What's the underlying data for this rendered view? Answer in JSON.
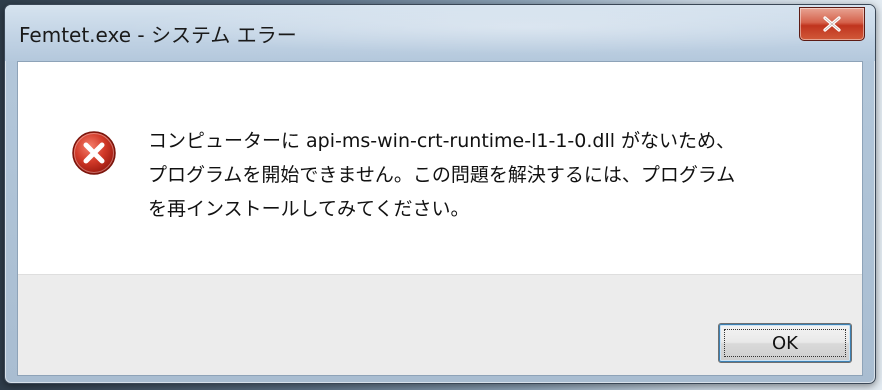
{
  "window": {
    "title": "Femtet.exe - システム エラー"
  },
  "message": {
    "icon": "error-icon",
    "lines": [
      "コンピューターに api-ms-win-crt-runtime-l1-1-0.dll がないため、",
      "プログラムを開始できません。この問題を解決するには、プログラム",
      "を再インストールしてみてください。"
    ]
  },
  "buttons": {
    "ok_label": "OK"
  },
  "colors": {
    "close_button": "#c0341e",
    "error_icon": "#c8281e",
    "footer_bg": "#ececec",
    "title_bar": "#c4d5e6"
  }
}
